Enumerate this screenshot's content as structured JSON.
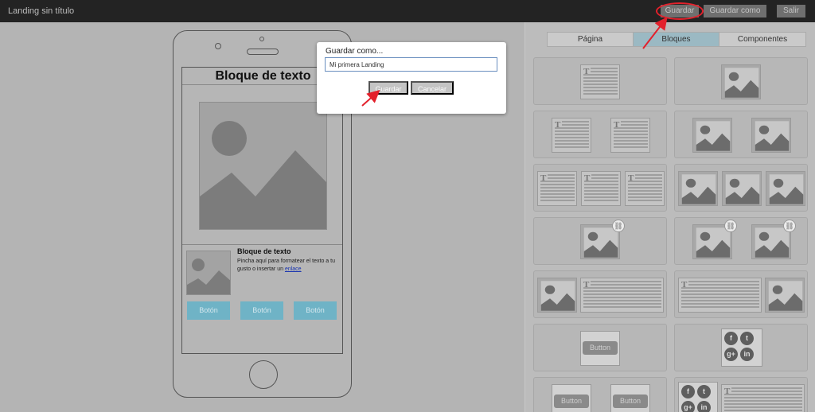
{
  "header": {
    "title": "Landing sin título",
    "buttons": {
      "guardar": "Guardar",
      "guardar_como": "Guardar como",
      "salir": "Salir"
    }
  },
  "phone_preview": {
    "title": "Bloque de texto",
    "text_block": {
      "title": "Bloque de texto",
      "body": "Pincha aquí para formatear el texto a tu gusto o insertar un ",
      "link": "enlace"
    },
    "buttons": [
      "Botón",
      "Botón",
      "Botón"
    ]
  },
  "modal": {
    "title": "Guardar como...",
    "input_value": "Mi primera Landing",
    "buttons": {
      "save": "Guardar",
      "cancel": "Cancelar"
    }
  },
  "sidebar": {
    "tabs": [
      {
        "label": "Página",
        "active": false
      },
      {
        "label": "Bloques",
        "active": true
      },
      {
        "label": "Componentes",
        "active": false
      }
    ],
    "blocks": [
      {
        "name": "text"
      },
      {
        "name": "image"
      },
      {
        "name": "two-text"
      },
      {
        "name": "two-images"
      },
      {
        "name": "three-text"
      },
      {
        "name": "three-images"
      },
      {
        "name": "image-link"
      },
      {
        "name": "two-image-links"
      },
      {
        "name": "image-text"
      },
      {
        "name": "text-image"
      },
      {
        "name": "button",
        "label": "Button"
      },
      {
        "name": "social-icons"
      },
      {
        "name": "two-buttons",
        "label": "Button"
      },
      {
        "name": "social-text"
      }
    ],
    "text_glyph": "T",
    "social": [
      "f",
      "t",
      "g+",
      "in"
    ]
  },
  "colors": {
    "accent": "#6fb3c6",
    "active_tab": "#9bb9c3",
    "annotation": "#e3202b",
    "topbar": "#232323"
  }
}
